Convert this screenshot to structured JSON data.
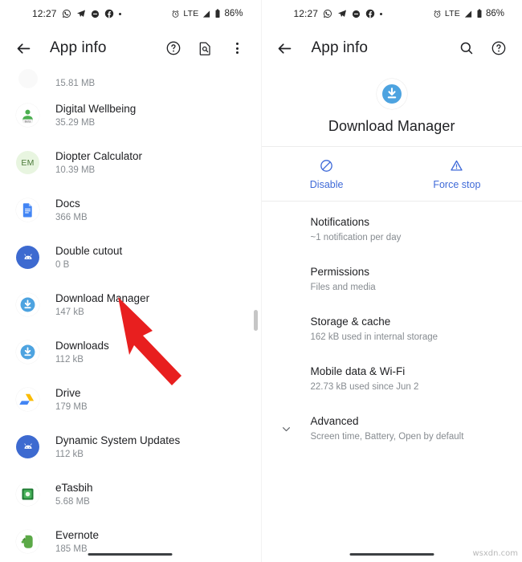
{
  "status_bar": {
    "time": "12:27",
    "left_icons": [
      "whatsapp-icon",
      "telegram-icon",
      "chat-icon",
      "facebook-icon",
      "more-dot-icon"
    ],
    "alarm_icon": "alarm-icon",
    "network": "LTE",
    "signal_icon": "signal-icon",
    "battery_icon": "battery-icon",
    "battery": "86%"
  },
  "left_screen": {
    "appbar": {
      "back": "back-arrow-icon",
      "title": "App info",
      "help_icon": "help-circle-icon",
      "doc_search_icon": "document-search-icon",
      "overflow_icon": "more-vert-icon"
    },
    "apps": [
      {
        "name": "",
        "size": "15.81 MB",
        "icon": "app-icon-partial",
        "partial": true
      },
      {
        "name": "Digital Wellbeing",
        "size": "35.29 MB",
        "icon": "digital-wellbeing-icon"
      },
      {
        "name": "Diopter Calculator",
        "size": "10.39 MB",
        "icon": "diopter-calculator-icon"
      },
      {
        "name": "Docs",
        "size": "366 MB",
        "icon": "google-docs-icon"
      },
      {
        "name": "Double cutout",
        "size": "0 B",
        "icon": "android-icon"
      },
      {
        "name": "Download Manager",
        "size": "147 kB",
        "icon": "download-manager-icon"
      },
      {
        "name": "Downloads",
        "size": "112 kB",
        "icon": "downloads-icon"
      },
      {
        "name": "Drive",
        "size": "179 MB",
        "icon": "google-drive-icon"
      },
      {
        "name": "Dynamic System Updates",
        "size": "112 kB",
        "icon": "android-icon"
      },
      {
        "name": "eTasbih",
        "size": "5.68 MB",
        "icon": "etasbih-icon"
      },
      {
        "name": "Evernote",
        "size": "185 MB",
        "icon": "evernote-icon"
      }
    ],
    "annotation": "red-arrow-pointing-to-download-manager"
  },
  "right_screen": {
    "appbar": {
      "back": "back-arrow-icon",
      "title": "App info",
      "search_icon": "search-icon",
      "help_icon": "help-circle-icon"
    },
    "app": {
      "icon": "download-manager-icon",
      "name": "Download Manager"
    },
    "actions": [
      {
        "label": "Disable",
        "icon": "disable-slash-icon"
      },
      {
        "label": "Force stop",
        "icon": "warning-triangle-icon"
      }
    ],
    "settings": [
      {
        "title": "Notifications",
        "subtitle": "~1 notification per day"
      },
      {
        "title": "Permissions",
        "subtitle": "Files and media"
      },
      {
        "title": "Storage & cache",
        "subtitle": "162 kB used in internal storage"
      },
      {
        "title": "Mobile data & Wi-Fi",
        "subtitle": "22.73 kB used since Jun 2"
      },
      {
        "title": "Advanced",
        "subtitle": "Screen time, Battery, Open by default",
        "expander": "chevron-down-icon"
      }
    ]
  },
  "watermark": "wsxdn.com",
  "colors": {
    "accent_blue": "#3f6ad8",
    "icon_blue": "#4da3e0",
    "text_primary": "#202124",
    "text_secondary": "#868b90",
    "annotation_red": "#e81f1f"
  }
}
